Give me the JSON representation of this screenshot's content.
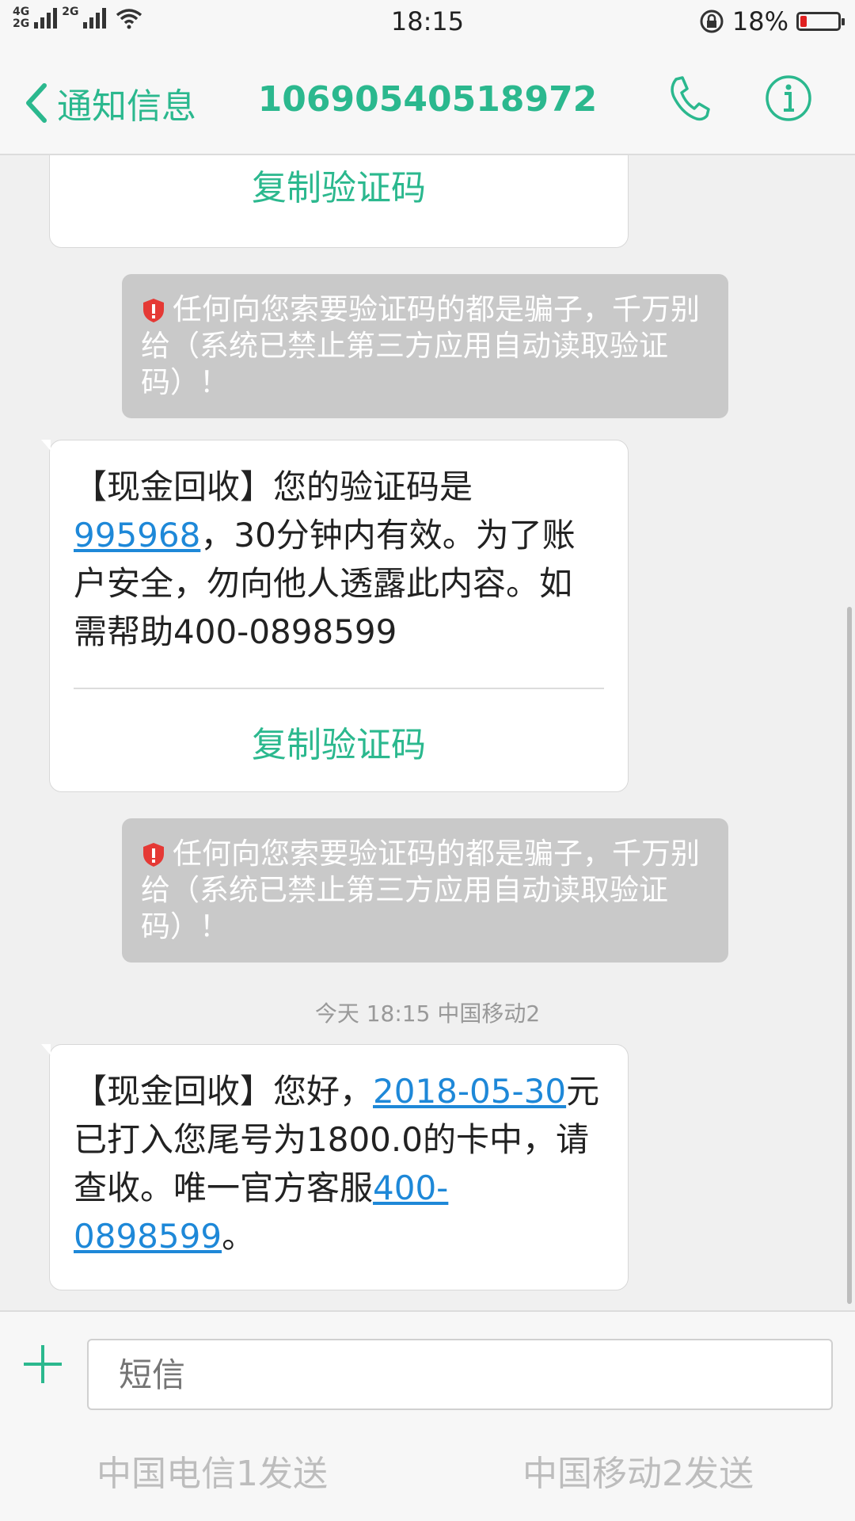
{
  "status_bar": {
    "network_top": "4G",
    "network_bottom": "2G",
    "network_second": "2G",
    "time": "18:15",
    "battery_percent_label": "18%",
    "battery_level": 0.18,
    "battery_color": "#e02020"
  },
  "header": {
    "back_label": "通知信息",
    "title": "10690540518972",
    "phone_icon": "phone-icon",
    "info_icon": "info-icon",
    "accent_color": "#2bb88e"
  },
  "messages": [
    {
      "copy_label": "复制验证码"
    },
    {
      "warning": "任何向您索要验证码的都是骗子，千万别给（系统已禁止第三方应用自动读取验证码）！"
    },
    {
      "prefix": "【现金回收】您的验证码是",
      "code": "995968",
      "rest": "，30分钟内有效。为了账户安全，勿向他人透露此内容。如需帮助400-0898599",
      "copy_label": "复制验证码"
    },
    {
      "warning": "任何向您索要验证码的都是骗子，千万别给（系统已禁止第三方应用自动读取验证码）！"
    },
    {
      "timestamp": "今天 18:15  中国移动2"
    },
    {
      "prefix": "【现金回收】您好，",
      "date_link": "2018-05-30",
      "middle": "元已打入您尾号为1800.0的卡中，请查收。唯一官方客服",
      "phone_link": "400-0898599",
      "suffix": "。"
    }
  ],
  "input": {
    "placeholder": "短信",
    "send_sim1": "中国电信1发送",
    "send_sim2": "中国移动2发送"
  }
}
